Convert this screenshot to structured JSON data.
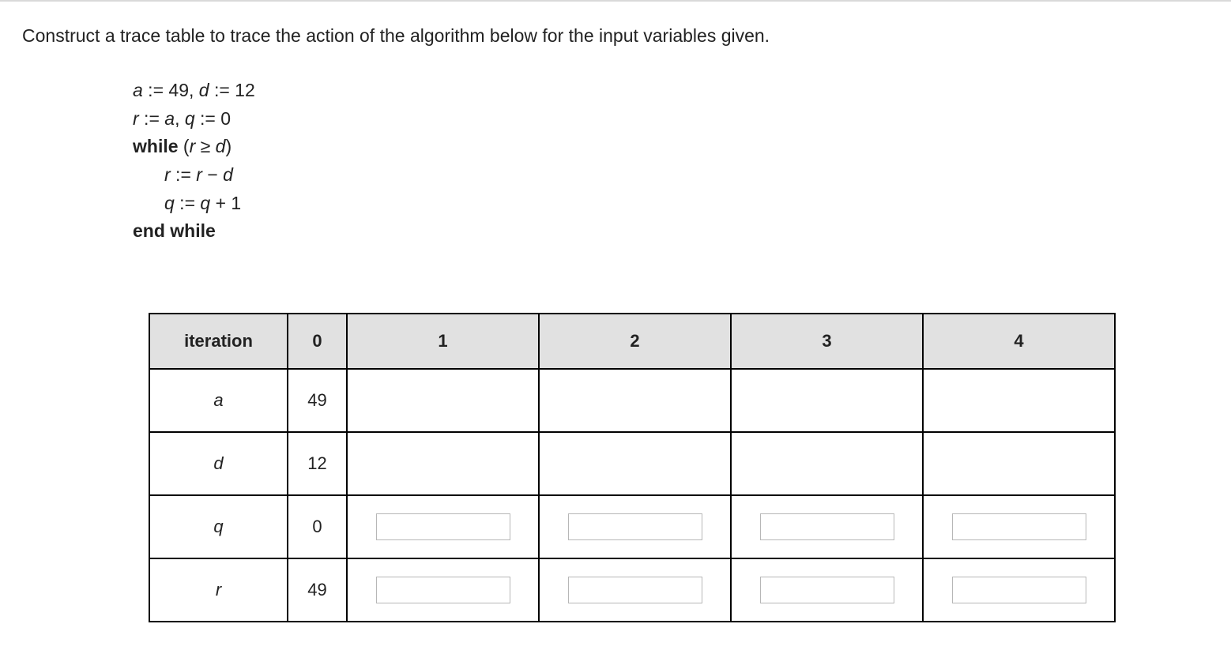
{
  "prompt": "Construct a trace table to trace the action of the algorithm below for the input variables given.",
  "algorithm": {
    "l1_a": "a",
    "l1_text1": " := 49, ",
    "l1_d": "d",
    "l1_text2": " := 12",
    "l2_r": "r",
    "l2_text1": " := ",
    "l2_a": "a",
    "l2_text2": ", ",
    "l2_q": "q",
    "l2_text3": " := 0",
    "l3_while": "while",
    "l3_open": " (",
    "l3_r": "r",
    "l3_ge": " ≥ ",
    "l3_d": "d",
    "l3_close": ")",
    "l4_r1": "r",
    "l4_text1": " := ",
    "l4_r2": "r",
    "l4_text2": " − ",
    "l4_d": "d",
    "l5_q1": "q",
    "l5_text1": " := ",
    "l5_q2": "q",
    "l5_text2": " + 1",
    "l6_end": "end while"
  },
  "table": {
    "header_label": "iteration",
    "iterations": [
      "0",
      "1",
      "2",
      "3",
      "4"
    ],
    "rows": [
      {
        "var": "a",
        "initial": "49",
        "inputs": [
          false,
          false,
          false,
          false
        ]
      },
      {
        "var": "d",
        "initial": "12",
        "inputs": [
          false,
          false,
          false,
          false
        ]
      },
      {
        "var": "q",
        "initial": "0",
        "inputs": [
          true,
          true,
          true,
          true
        ]
      },
      {
        "var": "r",
        "initial": "49",
        "inputs": [
          true,
          true,
          true,
          true
        ]
      }
    ]
  }
}
